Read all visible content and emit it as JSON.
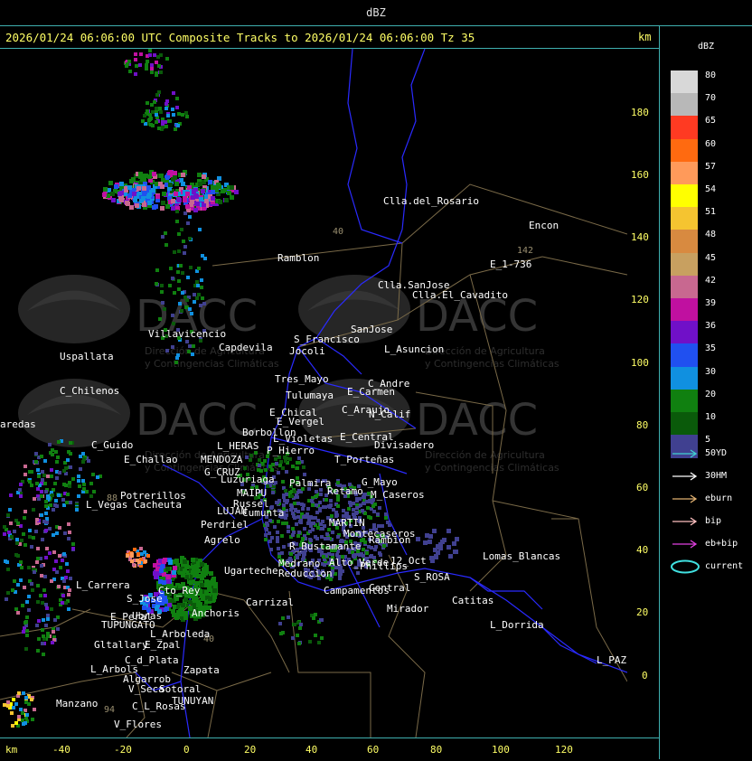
{
  "header": {
    "title": "dBZ"
  },
  "map_title": "2026/01/24 06:06:00 UTC Composite Tracks to 2026/01/24 06:06:00 Tz 35",
  "units": {
    "top_right": "km",
    "bottom_left": "km"
  },
  "x_axis": {
    "ticks": [
      "-40",
      "-20",
      "0",
      "20",
      "40",
      "60",
      "80",
      "100",
      "120"
    ]
  },
  "y_axis": {
    "ticks": [
      "180",
      "160",
      "140",
      "120",
      "100",
      "80",
      "60",
      "40",
      "20",
      "0"
    ]
  },
  "legend": {
    "title": "dBZ",
    "levels": [
      {
        "label": "80",
        "color": "#d8d8d8"
      },
      {
        "label": "70",
        "color": "#b8b8b8"
      },
      {
        "label": "65",
        "color": "#ff3a22"
      },
      {
        "label": "60",
        "color": "#ff6a10"
      },
      {
        "label": "57",
        "color": "#ff9a5a"
      },
      {
        "label": "54",
        "color": "#ffff00"
      },
      {
        "label": "51",
        "color": "#f5c430"
      },
      {
        "label": "48",
        "color": "#d88a40"
      },
      {
        "label": "45",
        "color": "#c8a060"
      },
      {
        "label": "42",
        "color": "#c86890"
      },
      {
        "label": "39",
        "color": "#c010a0"
      },
      {
        "label": "36",
        "color": "#7010c8"
      },
      {
        "label": "35",
        "color": "#2050f0"
      },
      {
        "label": "30",
        "color": "#1090e0"
      },
      {
        "label": "20",
        "color": "#108010"
      },
      {
        "label": "10",
        "color": "#0a5a0a"
      },
      {
        "label": "5",
        "color": "#404090"
      }
    ]
  },
  "tracks": [
    {
      "label": "50YD",
      "color": "#40d0d0"
    },
    {
      "label": "30HM",
      "color": "#ffffff"
    },
    {
      "label": "eburn",
      "color": "#e0b070"
    },
    {
      "label": "bip",
      "color": "#ffc0c0"
    },
    {
      "label": "eb+bip",
      "color": "#e040e0"
    },
    {
      "label": "current",
      "color": "#40e0e0"
    }
  ],
  "watermark": {
    "brand": "DACC",
    "line1": "Dirección de Agricultura",
    "line2": "y Contingencias Climáticas"
  },
  "places": [
    "Clla.del_Rosario",
    "Encon",
    "E_1-736",
    "Ramblon",
    "Clla.SanJose",
    "Clla.El_Cavadito",
    "Villavicencio",
    "Capdevila",
    "S_Francisco",
    "SanJose",
    "L_Asuncion",
    "Uspallata",
    "Jocoli",
    "Tres_Mayo",
    "C_Andre",
    "C_Chilenos",
    "Tulumaya",
    "E_Carmen",
    "E_Chical",
    "C_Araujo",
    "N_Calif",
    "E_Vergel",
    "Borbollon",
    "aredas",
    "L_Violetas",
    "E_Central",
    "Divisadero",
    "C_Guido",
    "L_HERAS",
    "P_Hierro",
    "E_Challao",
    "MENDOZA",
    "T_Porteñas",
    "G_CRUZ",
    "Luzuriaga",
    "Palmira",
    "Retamo",
    "G_Mayo",
    "MAIPU",
    "M_Caseros",
    "Potrerillos",
    "Russel",
    "L_Vegas",
    "Cacheuta",
    "LUJAN",
    "Cumunta",
    "MARTIN",
    "Perdriel",
    "Montecaseros",
    "Agrelo",
    "Rambion",
    "R_Bustamante",
    "Lomas_Blancas",
    "Medrano",
    "Ugarteche",
    "Alto_Verde",
    "Phillips",
    "12_Oct",
    "Reduccion",
    "S_ROSA",
    "Campamentos",
    "L_Carrera",
    "Cto_Rey",
    "S_Jose",
    "Central",
    "Carrizal",
    "Catitas",
    "Anchoris",
    "Mirador",
    "E_Peral",
    "Ubras",
    "TUPUNGATO",
    "L_Dorrida",
    "L_Arboleda",
    "Gltallary",
    "E_Zpal",
    "C_d_Plata",
    "L_PAZ",
    "L_Arbols",
    "Zapata",
    "Algarrob",
    "V_Seca",
    "Sotoral",
    "TUNUYAN",
    "Manzano",
    "C_L_Rosas",
    "V_Flores"
  ],
  "road_numbers": [
    "40",
    "142",
    "88",
    "40",
    "94"
  ]
}
